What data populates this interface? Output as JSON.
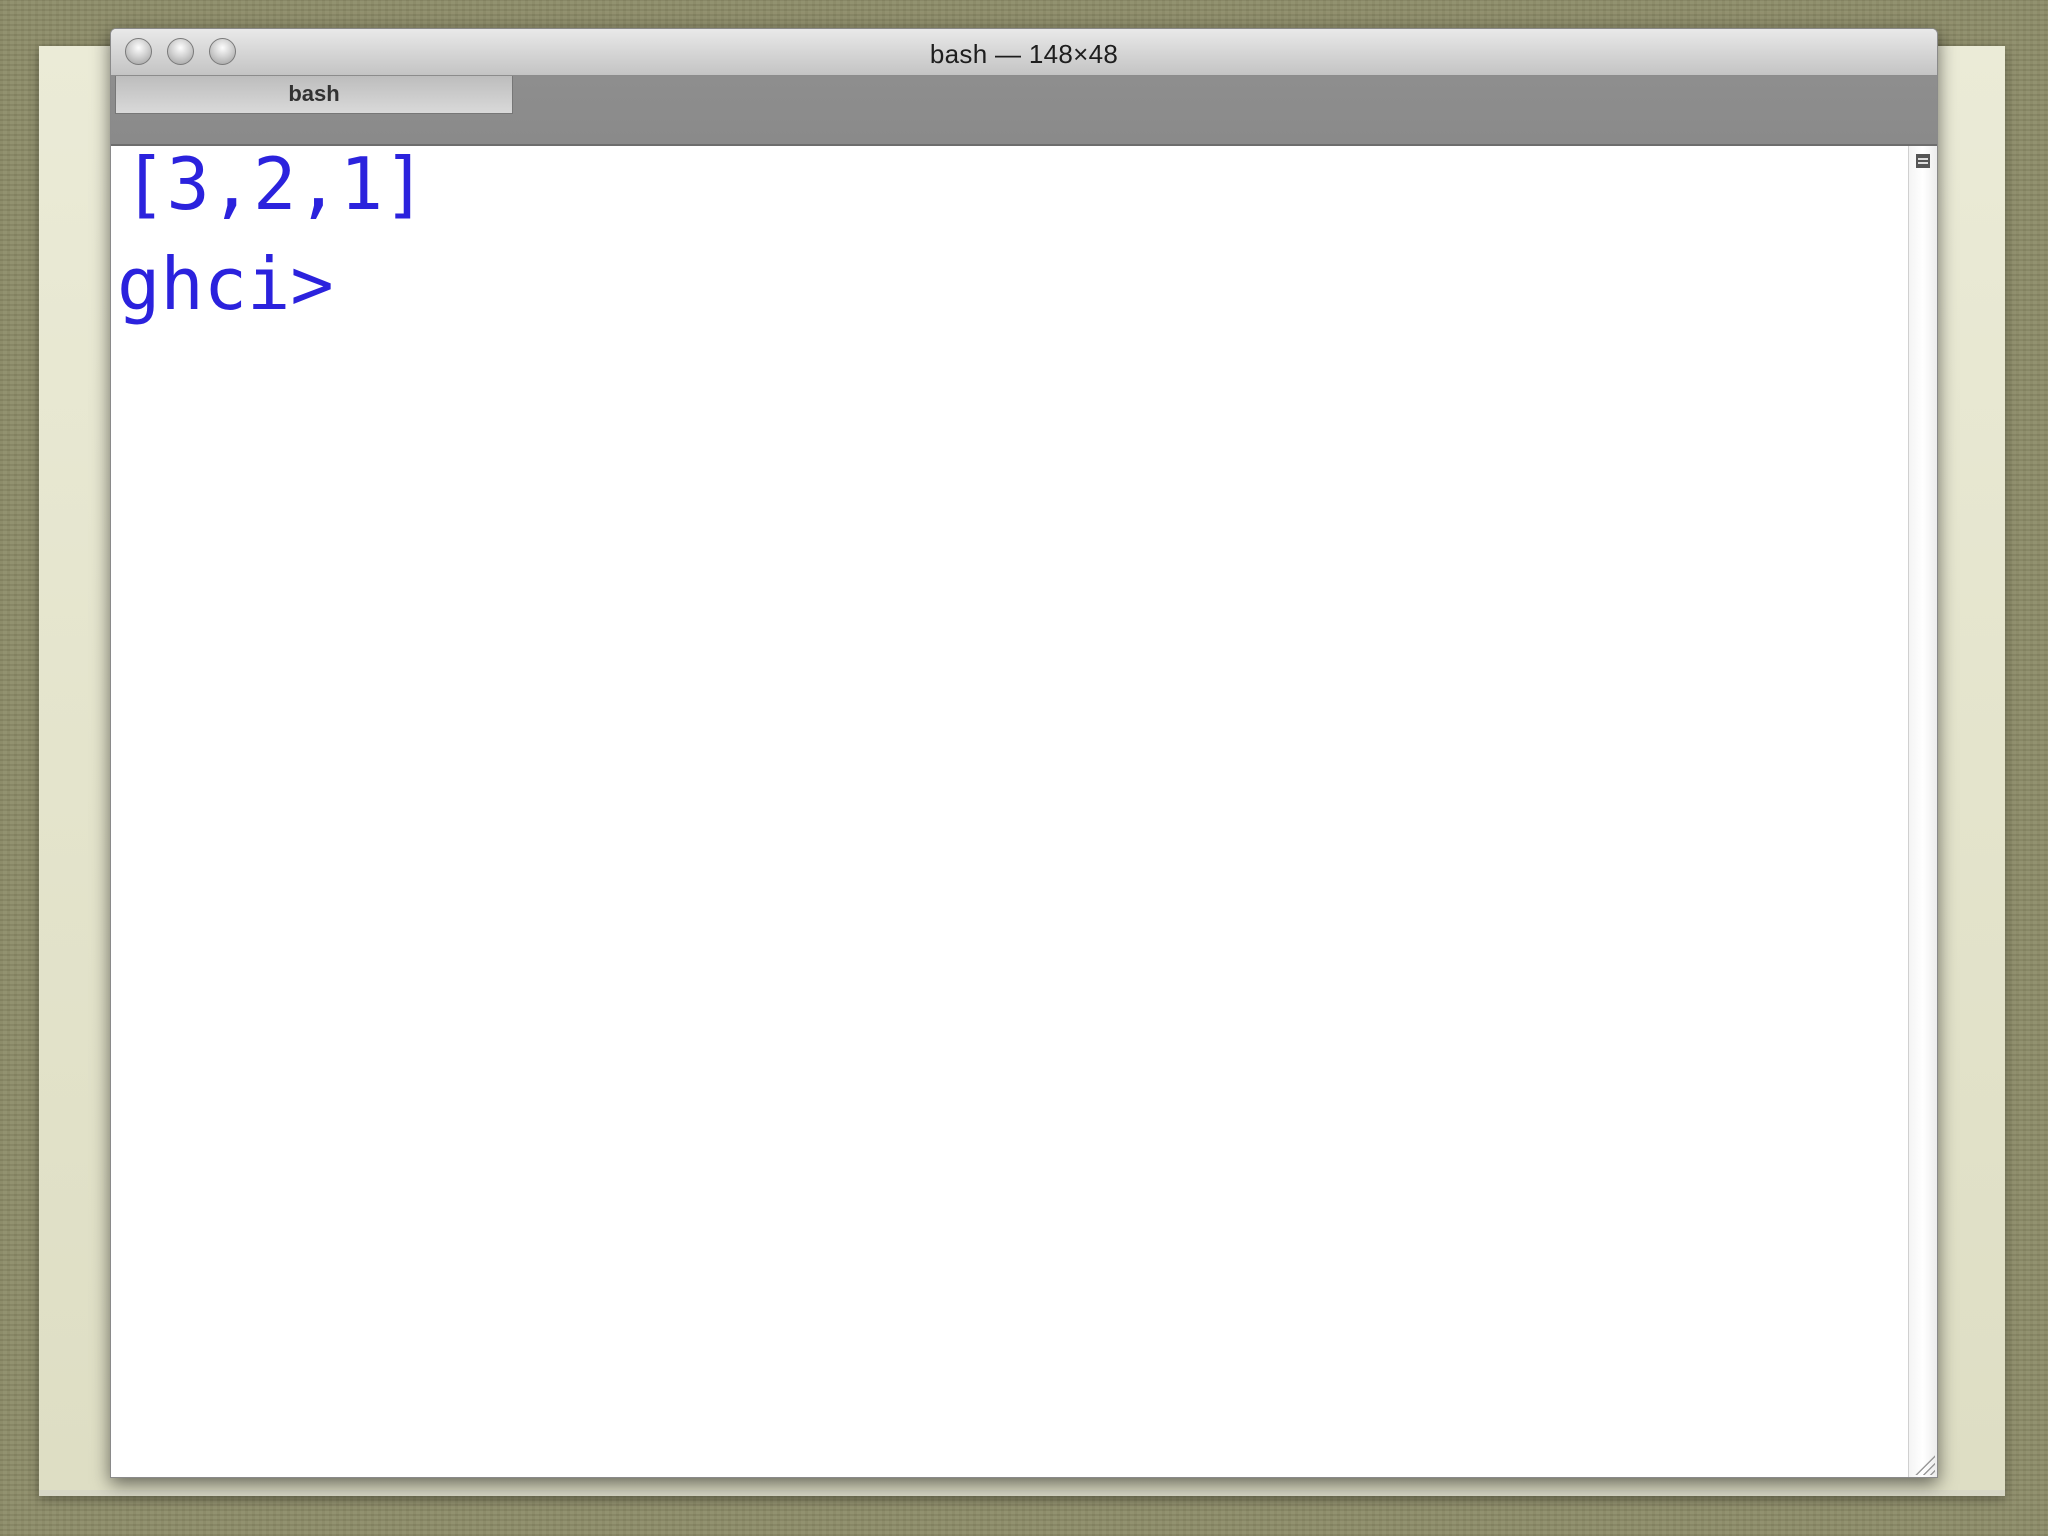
{
  "window": {
    "title": "bash — 148×48"
  },
  "tabs": [
    {
      "label": "bash",
      "active": true
    }
  ],
  "terminal": {
    "lines": [
      "[3,2,1]",
      "ghci>"
    ],
    "text_color": "#2b22dd",
    "background": "#ffffff"
  },
  "icons": {
    "split": "split-pane-icon",
    "resize": "resize-grip-icon"
  }
}
